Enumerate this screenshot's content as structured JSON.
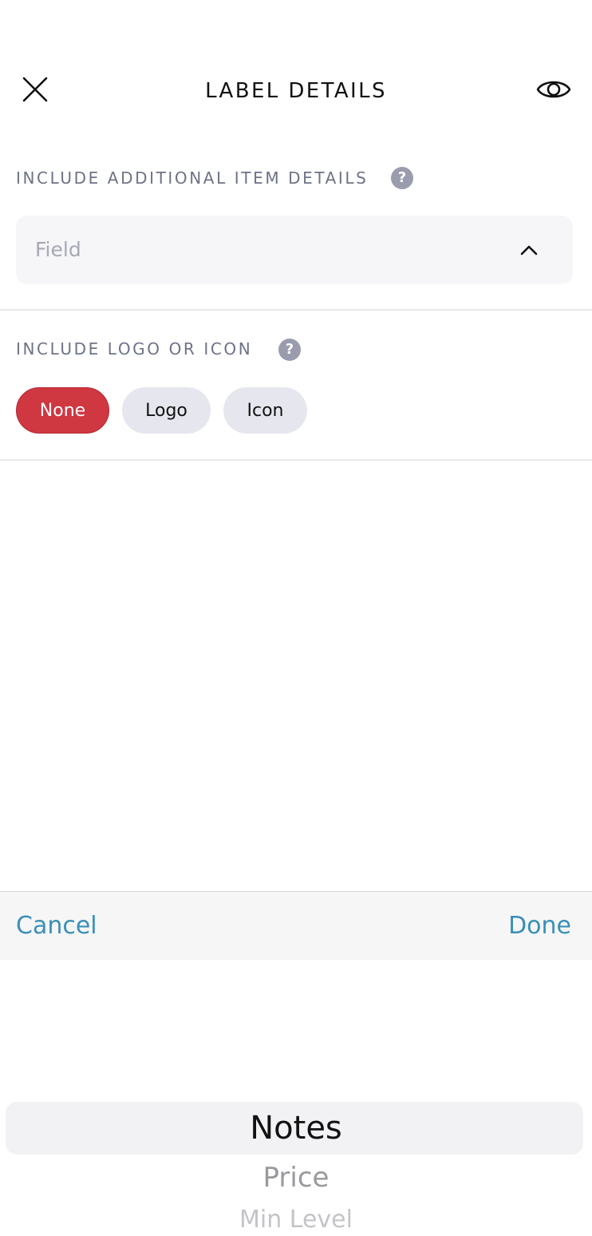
{
  "header": {
    "title": "LABEL DETAILS",
    "close_icon": "close-icon",
    "preview_icon": "eye-icon"
  },
  "item_details": {
    "label": "INCLUDE ADDITIONAL ITEM DETAILS",
    "help_icon": "help-icon",
    "help_glyph": "?",
    "field": {
      "placeholder": "Field",
      "icon": "chevron-up-icon"
    }
  },
  "logo_icon": {
    "label": "INCLUDE LOGO OR ICON",
    "help_icon": "help-icon",
    "help_glyph": "?",
    "options": [
      "None",
      "Logo",
      "Icon"
    ],
    "selected": "None"
  },
  "picker_toolbar": {
    "cancel_label": "Cancel",
    "done_label": "Done"
  },
  "picker": {
    "options": [
      "Notes",
      "Price",
      "Min Level"
    ],
    "selected": "Notes"
  },
  "colors": {
    "accent": "#cf3741",
    "link": "#3b8fb8",
    "section_label": "#6e7287"
  }
}
